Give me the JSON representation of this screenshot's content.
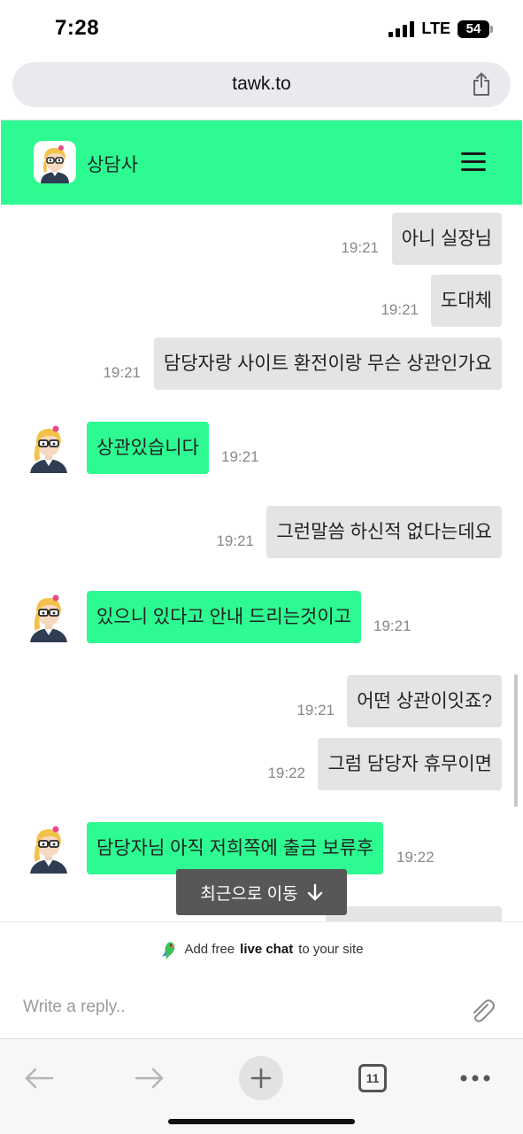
{
  "status_bar": {
    "time": "7:28",
    "network": "LTE",
    "battery": "54"
  },
  "browser": {
    "url": "tawk.to",
    "tab_count": "11"
  },
  "chat": {
    "agent_name": "상담사",
    "messages": [
      {
        "side": "out",
        "text": "아니 실장님",
        "time": "19:21"
      },
      {
        "side": "out",
        "text": "도대체",
        "time": "19:21"
      },
      {
        "side": "out",
        "text": "담당자랑 사이트 환전이랑 무슨 상관인가요",
        "time": "19:21"
      },
      {
        "side": "in",
        "text": "상관있습니다",
        "time": "19:21"
      },
      {
        "side": "out",
        "text": "그런말씀 하신적 없다는데요",
        "time": "19:21"
      },
      {
        "side": "in",
        "text": "있으니 있다고 안내 드리는것이고",
        "time": "19:21"
      },
      {
        "side": "out",
        "text": "어떤 상관이잇죠?",
        "time": "19:21"
      },
      {
        "side": "out",
        "text": "그럼 담당자 휴무이면",
        "time": "19:22"
      },
      {
        "side": "in",
        "text": "담당자님 아직 저희쪽에 출금 보류후",
        "time": "19:22"
      }
    ],
    "jump_to_recent": "최근으로 이동",
    "powered_prefix": "Add free",
    "powered_bold": "live chat",
    "powered_suffix": "to your site",
    "reply_placeholder": "Write a reply.."
  },
  "icons": {
    "share": "share-icon",
    "menu": "hamburger-menu-icon",
    "attach": "paperclip-icon",
    "back": "back-arrow-icon",
    "forward": "forward-arrow-icon",
    "new_tab": "plus-icon",
    "tabs": "tabs-icon",
    "more": "more-dots-icon"
  },
  "colors": {
    "accent": "#2dfb91",
    "outgoing_bubble": "#e4e4e4",
    "jump_button": "#575757"
  }
}
